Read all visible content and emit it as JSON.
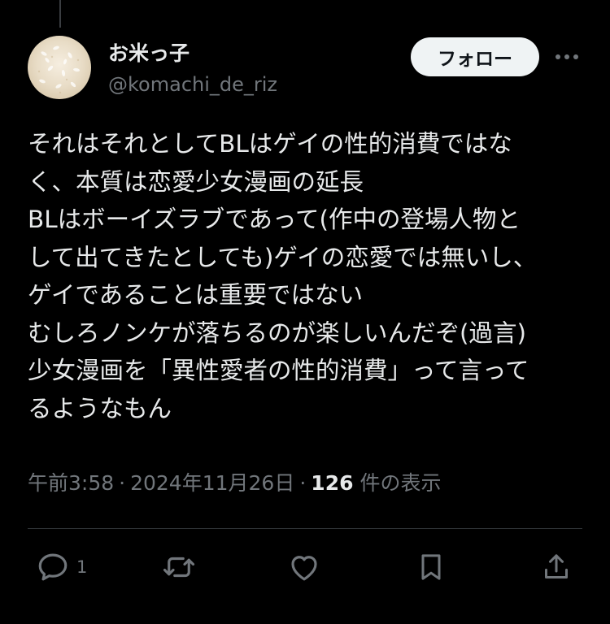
{
  "author": {
    "display_name": "お米っ子",
    "handle": "@komachi_de_riz"
  },
  "follow_button": {
    "label": "フォロー"
  },
  "tweet": {
    "lines": [
      "それはそれとしてBLはゲイの性的消費ではな",
      "く、本質は恋愛少女漫画の延長",
      "BLはボーイズラブであって(作中の登場人物と",
      "して出てきたとしても)ゲイの恋愛では無いし、",
      "ゲイであることは重要ではない",
      "むしろノンケが落ちるのが楽しいんだぞ(過言)",
      "少女漫画を「異性愛者の性的消費」って言って",
      "るようなもん"
    ]
  },
  "meta": {
    "time": "午前3:58",
    "separator": "·",
    "date": "2024年11月26日",
    "views_count": "126",
    "views_label": "件の表示"
  },
  "actions": {
    "reply_icon": "reply-icon",
    "reply_count": "1",
    "retweet_icon": "retweet-icon",
    "like_icon": "heart-icon",
    "bookmark_icon": "bookmark-icon",
    "share_icon": "share-icon"
  },
  "colors": {
    "background": "#000000",
    "text_primary": "#e7e9ea",
    "text_secondary": "#71767b",
    "divider": "#2f3336",
    "follow_button_bg": "#eff3f4",
    "follow_button_text": "#0f1419"
  }
}
